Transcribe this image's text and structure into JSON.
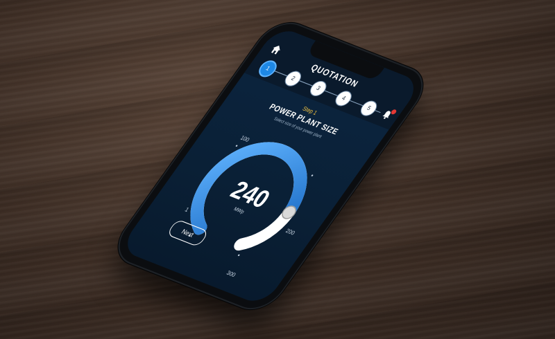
{
  "header": {
    "title": "QUOTATION"
  },
  "stepper": {
    "steps": [
      "1",
      "2",
      "3",
      "4",
      "5"
    ],
    "active": "1"
  },
  "section": {
    "step_label": "Step 1",
    "title": "POWER PLANT SIZE",
    "subtitle": "Select size of your power plant"
  },
  "gauge": {
    "value": "240",
    "unit": "MWp",
    "tick_labels": [
      "1",
      "100",
      "200",
      "300"
    ],
    "min": 1,
    "max": 300,
    "level": 240
  },
  "actions": {
    "next_label": "Next"
  },
  "colors": {
    "accent": "#1e88e5",
    "accent_light": "#61b4ff",
    "background": "#0a2036",
    "badge": "#e53935",
    "step_label": "#f4c542"
  },
  "icons": {
    "home": "home-icon",
    "notifications": "bell-icon",
    "handle": "slider-knob-icon"
  }
}
